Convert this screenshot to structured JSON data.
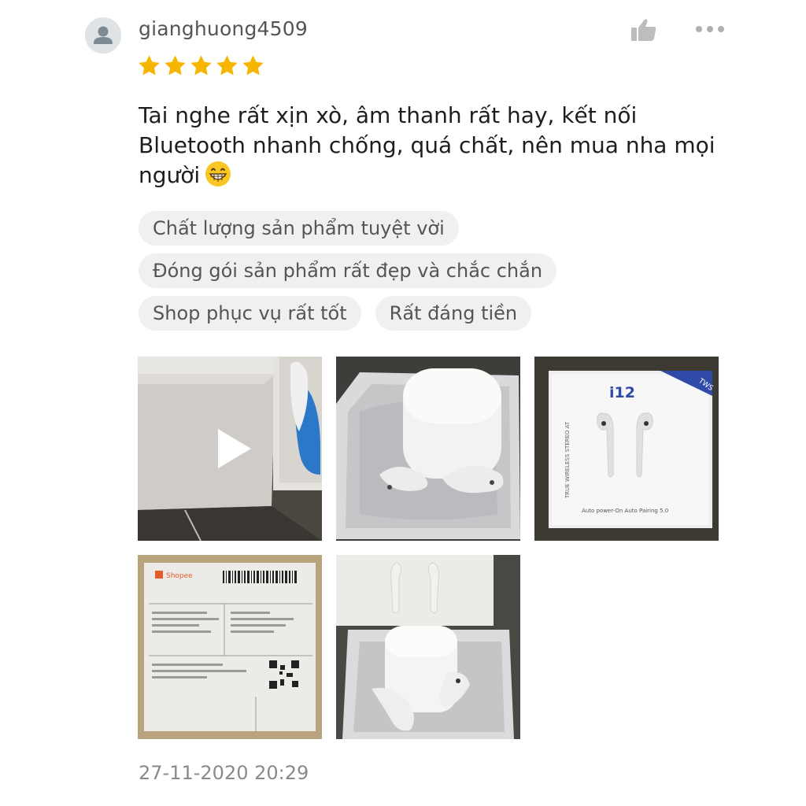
{
  "review": {
    "username": "gianghuong4509",
    "rating": 5,
    "rating_max": 5,
    "text": "Tai nghe rất xịn xò, âm thanh rất hay, kết nối Bluetooth nhanh chống, quá chất, nên mua nha mọi người",
    "emoji_icon": "grinning-face-icon",
    "timestamp": "27-11-2020 20:29"
  },
  "tags": [
    [
      "Chất lượng sản phẩm tuyệt vời"
    ],
    [
      "Đóng gói sản phẩm rất đẹp và chắc chắn"
    ],
    [
      "Shop phục vụ rất tốt",
      "Rất đáng tiền"
    ]
  ],
  "media": [
    {
      "kind": "video",
      "icon": "play-icon"
    },
    {
      "kind": "photo"
    },
    {
      "kind": "photo",
      "label": "i12",
      "badge": "TWS",
      "side": "TRUE WIRELESS STEREO AT",
      "caption": "Auto power-On Auto Pairing 5.0"
    },
    {
      "kind": "photo",
      "label": "Shopee"
    },
    {
      "kind": "photo"
    }
  ],
  "colors": {
    "star": "#f7b500",
    "username": "#555555",
    "tag_bg": "#f0f0f0",
    "timestamp": "#8a8a8a",
    "icon_gray": "#bdbdbd"
  }
}
